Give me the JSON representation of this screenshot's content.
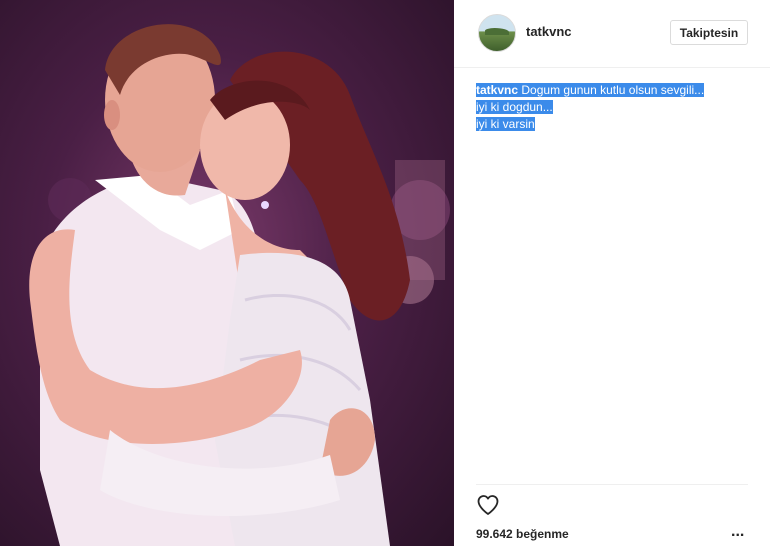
{
  "post": {
    "username": "tatkvnc",
    "follow_label": "Takiptesin",
    "caption": {
      "user": "tatkvnc",
      "line1": "Dogum gunun kutlu olsun sevgili...",
      "line2": "iyi ki dogdun...",
      "line3": "iyi ki varsin"
    },
    "likes_text": "99.642 beğenme",
    "more_label": "..."
  },
  "colors": {
    "selection": "#3b8bea",
    "text": "#262626",
    "border": "#dbdbdb"
  },
  "icons": {
    "like": "heart-outline-icon",
    "more": "more-options-icon"
  }
}
